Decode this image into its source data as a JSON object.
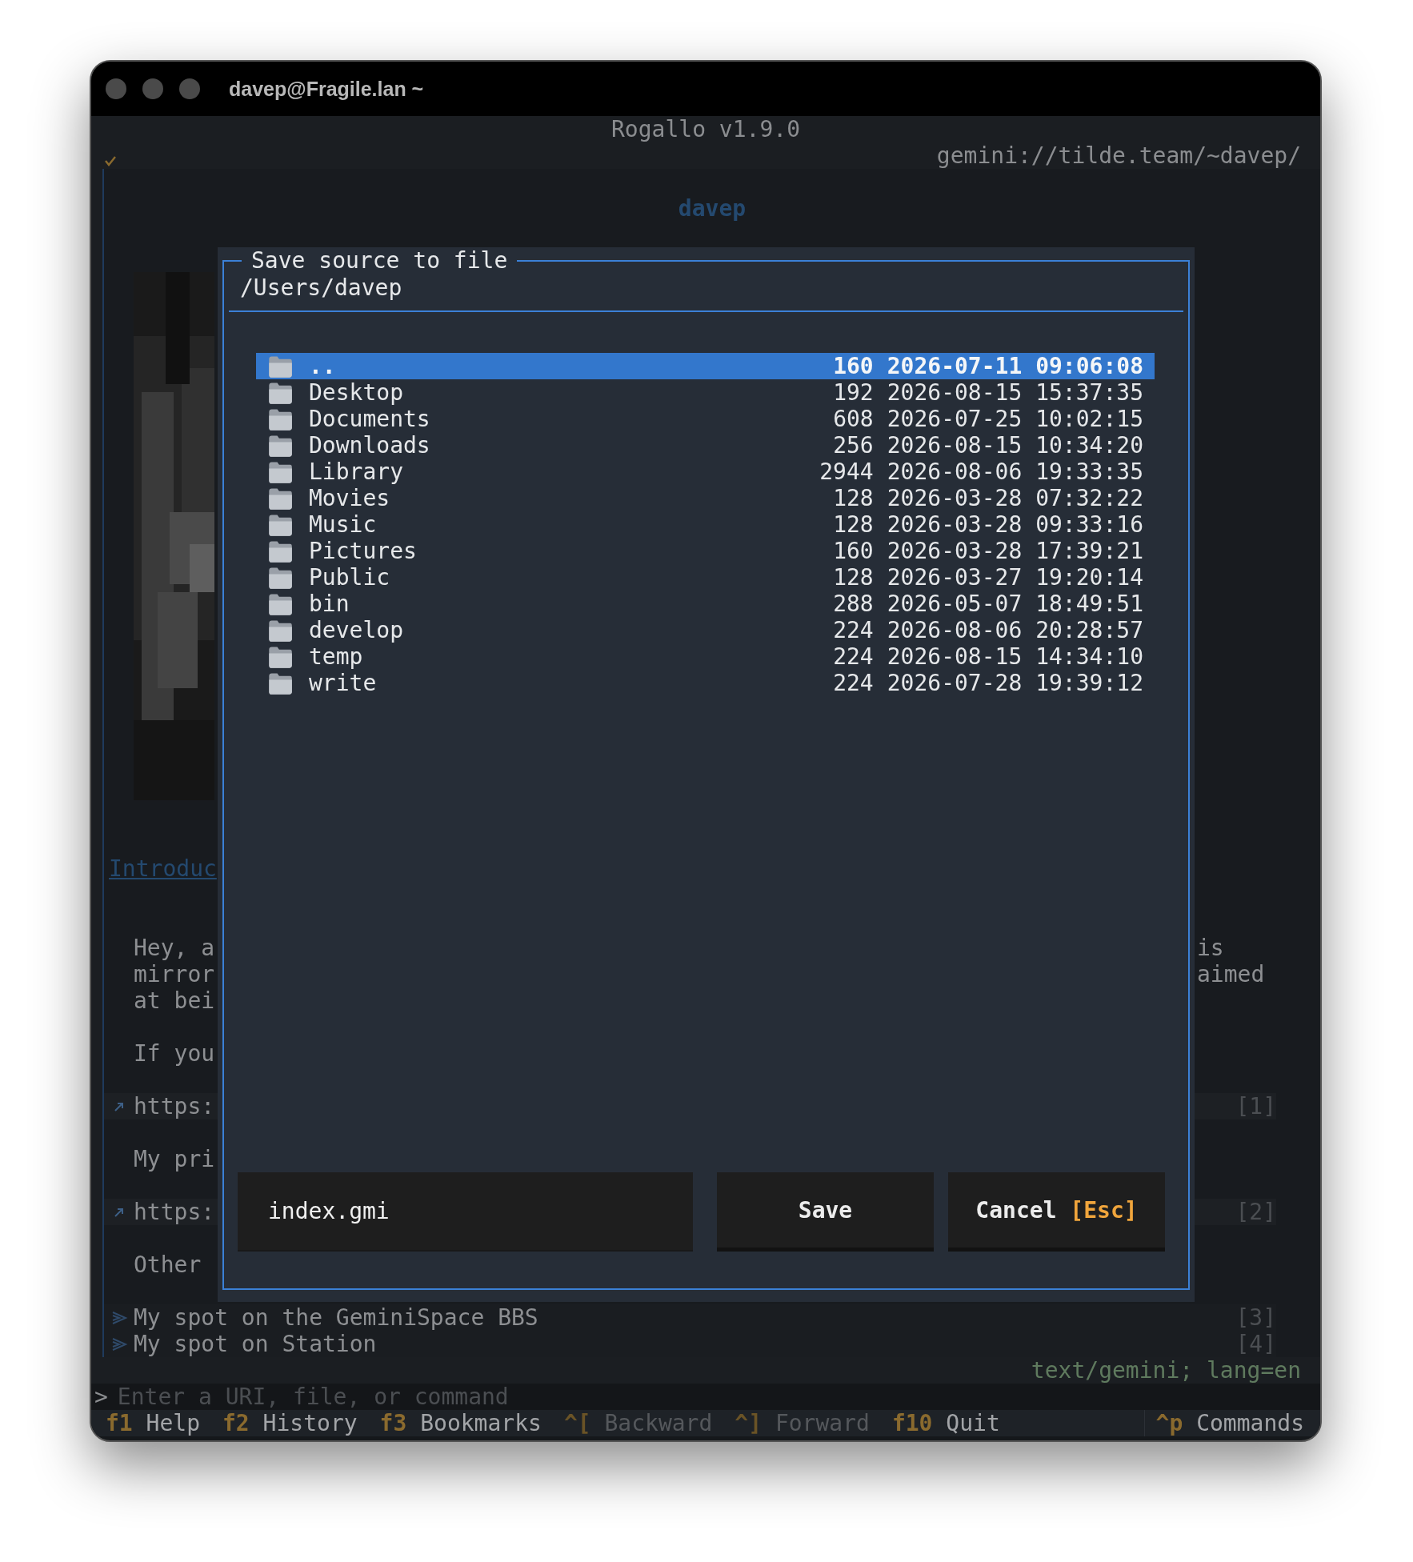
{
  "window": {
    "title": "davep@Fragile.lan ~"
  },
  "app": {
    "title": "Rogallo v1.9.0",
    "url": "gemini://tilde.team/~davep/"
  },
  "page": {
    "heading": "davep",
    "lines": [
      {
        "kind": "link-heading",
        "text": "Introduc"
      },
      {
        "kind": "blank"
      },
      {
        "kind": "blank"
      },
      {
        "kind": "text",
        "text": "Hey, a",
        "tail": "is"
      },
      {
        "kind": "text",
        "text": "mirror",
        "tail": "aimed"
      },
      {
        "kind": "text",
        "text": "at bei"
      },
      {
        "kind": "blank"
      },
      {
        "kind": "text",
        "text": "If you"
      },
      {
        "kind": "blank"
      },
      {
        "kind": "external-link",
        "text": "https:",
        "index": "[1]"
      },
      {
        "kind": "blank"
      },
      {
        "kind": "text",
        "text": "My pri"
      },
      {
        "kind": "blank"
      },
      {
        "kind": "external-link",
        "text": "https:",
        "index": "[2]"
      },
      {
        "kind": "blank"
      },
      {
        "kind": "text",
        "text": "Other"
      },
      {
        "kind": "blank"
      },
      {
        "kind": "gemini-link",
        "text": "My spot on the GeminiSpace BBS",
        "index": "[3]"
      },
      {
        "kind": "gemini-link",
        "text": "My spot on Station",
        "index": "[4]"
      }
    ]
  },
  "mime": "text/gemini; lang=en",
  "command_input": {
    "prompt": ">",
    "placeholder": "Enter a URI, file, or command"
  },
  "footer": {
    "keys": [
      {
        "key": "f1",
        "label": "Help",
        "disabled": false
      },
      {
        "key": "f2",
        "label": "History",
        "disabled": false
      },
      {
        "key": "f3",
        "label": "Bookmarks",
        "disabled": false
      },
      {
        "key": "^[",
        "label": "Backward",
        "disabled": true
      },
      {
        "key": "^]",
        "label": "Forward",
        "disabled": true
      },
      {
        "key": "f10",
        "label": "Quit",
        "disabled": false
      }
    ],
    "commands": {
      "key": "^p",
      "label": "Commands"
    }
  },
  "dialog": {
    "title": "Save source to file",
    "path": "/Users/davep",
    "entries": [
      {
        "name": "..",
        "size": "160",
        "modified": "2026-07-11 09:06:08",
        "selected": true
      },
      {
        "name": "Desktop",
        "size": "192",
        "modified": "2026-08-15 15:37:35",
        "selected": false
      },
      {
        "name": "Documents",
        "size": "608",
        "modified": "2026-07-25 10:02:15",
        "selected": false
      },
      {
        "name": "Downloads",
        "size": "256",
        "modified": "2026-08-15 10:34:20",
        "selected": false
      },
      {
        "name": "Library",
        "size": "2944",
        "modified": "2026-08-06 19:33:35",
        "selected": false
      },
      {
        "name": "Movies",
        "size": "128",
        "modified": "2026-03-28 07:32:22",
        "selected": false
      },
      {
        "name": "Music",
        "size": "128",
        "modified": "2026-03-28 09:33:16",
        "selected": false
      },
      {
        "name": "Pictures",
        "size": "160",
        "modified": "2026-03-28 17:39:21",
        "selected": false
      },
      {
        "name": "Public",
        "size": "128",
        "modified": "2026-03-27 19:20:14",
        "selected": false
      },
      {
        "name": "bin",
        "size": "288",
        "modified": "2026-05-07 18:49:51",
        "selected": false
      },
      {
        "name": "develop",
        "size": "224",
        "modified": "2026-08-06 20:28:57",
        "selected": false
      },
      {
        "name": "temp",
        "size": "224",
        "modified": "2026-08-15 14:34:10",
        "selected": false
      },
      {
        "name": "write",
        "size": "224",
        "modified": "2026-07-28 19:39:12",
        "selected": false
      }
    ],
    "filename": "index.gmi",
    "buttons": [
      {
        "label": "Save"
      },
      {
        "label": "Cancel",
        "key": "[Esc]"
      }
    ]
  }
}
